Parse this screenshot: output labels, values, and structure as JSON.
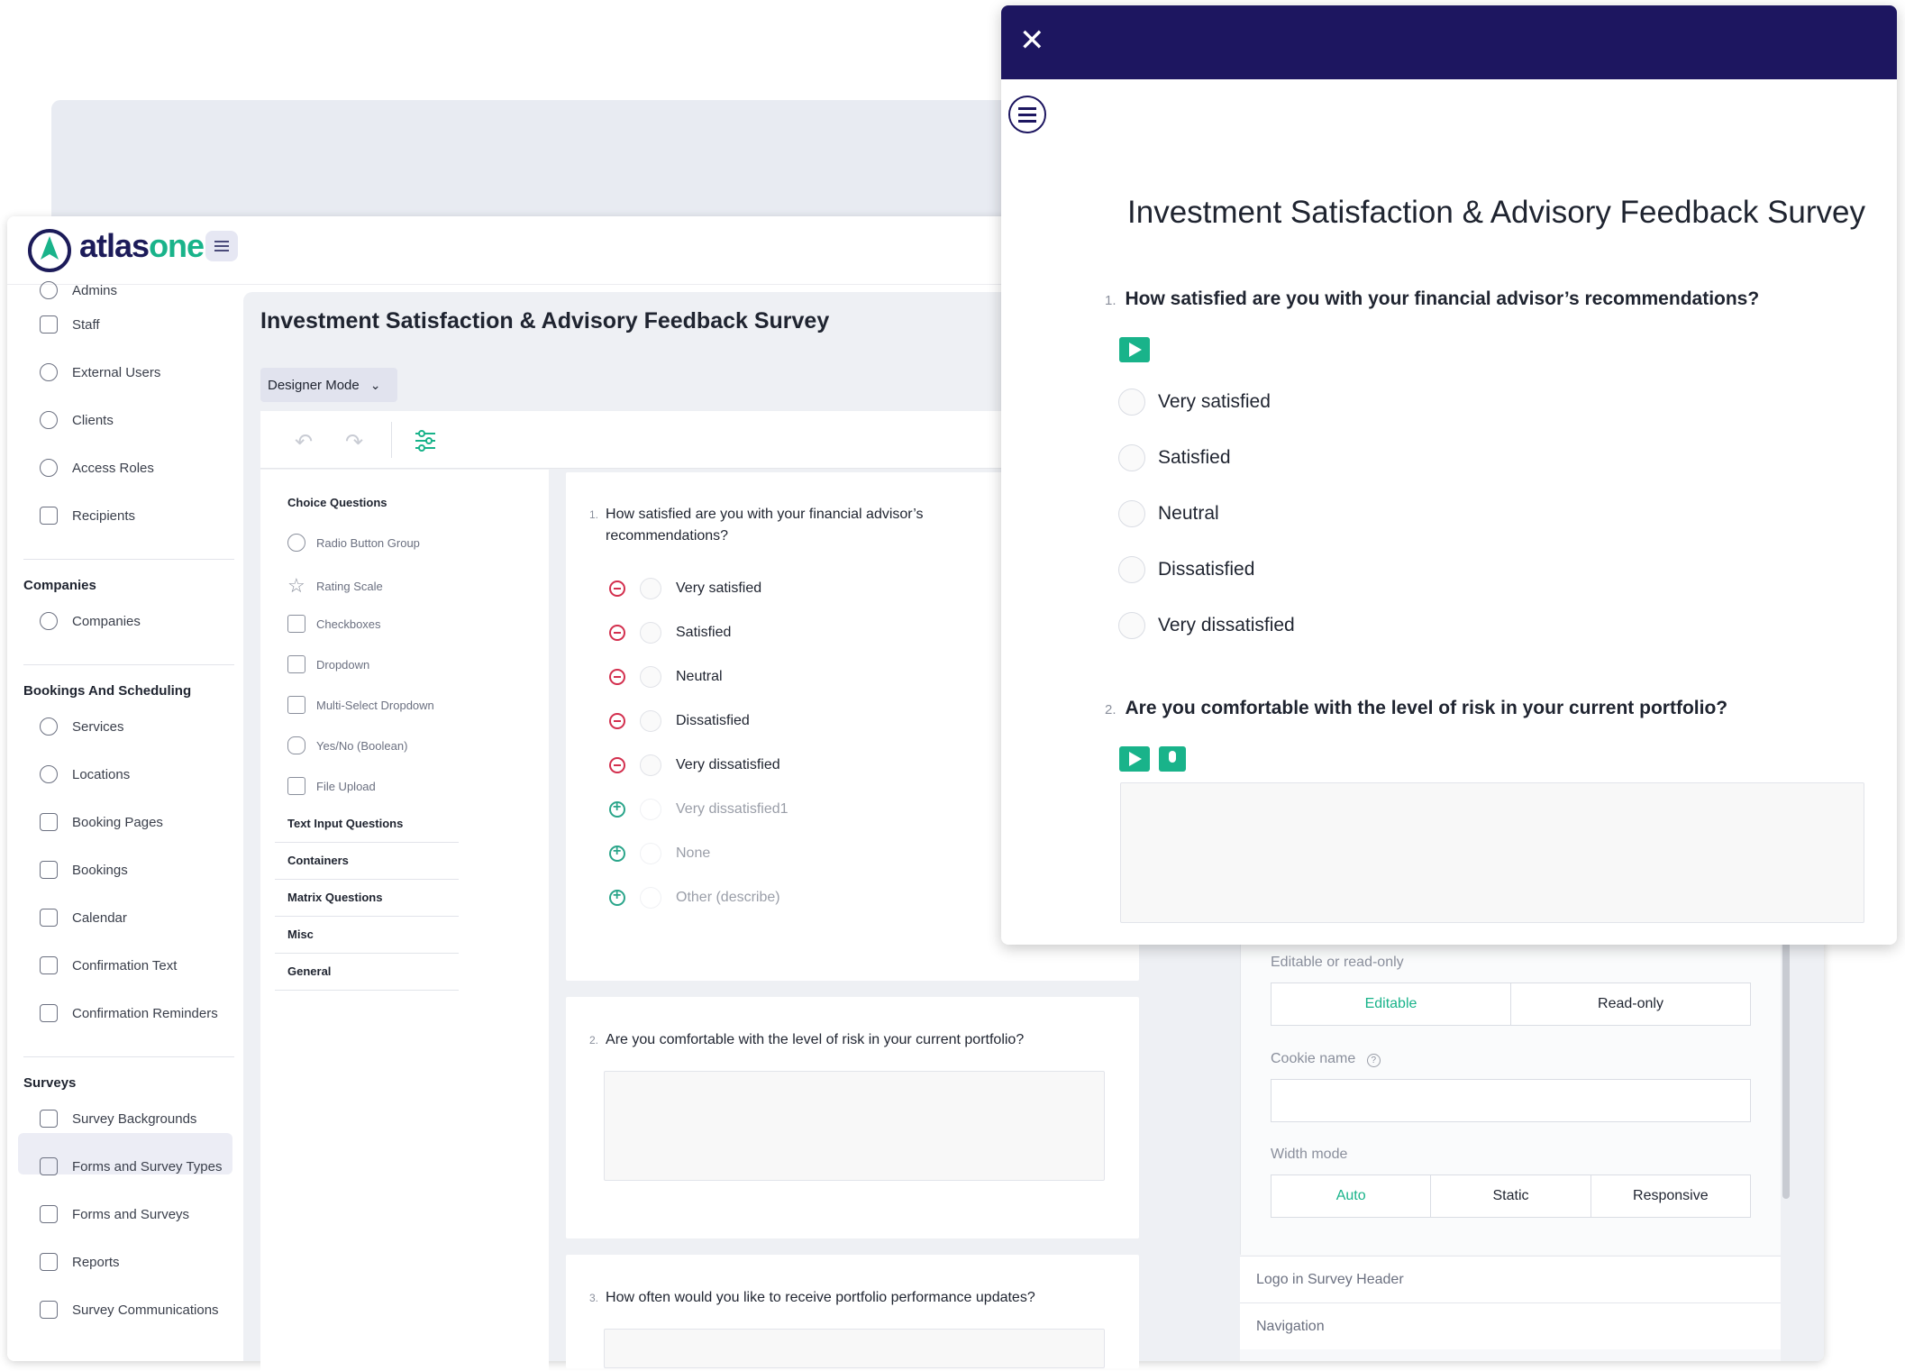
{
  "brand": {
    "logo_text_a": "atlas",
    "logo_text_b": "one"
  },
  "sidebar": {
    "cut_item": "Admins",
    "items_top": [
      "Staff",
      "External Users",
      "Clients",
      "Access Roles",
      "Recipients"
    ],
    "companies": {
      "heading": "Companies",
      "items": [
        "Companies"
      ]
    },
    "bookings": {
      "heading": "Bookings And Scheduling",
      "items": [
        "Services",
        "Locations",
        "Booking Pages",
        "Bookings",
        "Calendar",
        "Confirmation Text",
        "Confirmation Reminders"
      ]
    },
    "surveys": {
      "heading": "Surveys",
      "items": [
        "Survey Backgrounds",
        "Forms and Survey Types",
        "Forms and Surveys",
        "Reports",
        "Survey Communications"
      ],
      "active": "Forms and Survey Types"
    }
  },
  "editor": {
    "title": "Investment Satisfaction & Advisory Feedback Survey",
    "mode": "Designer Mode",
    "toolbox": {
      "choice_heading": "Choice Questions",
      "choice_items": [
        "Radio Button Group",
        "Rating Scale",
        "Checkboxes",
        "Dropdown",
        "Multi-Select Dropdown",
        "Yes/No (Boolean)",
        "File Upload"
      ],
      "categories": [
        "Text Input Questions",
        "Containers",
        "Matrix Questions",
        "Misc",
        "General"
      ]
    },
    "q1": {
      "num": "1.",
      "text_line1": "How satisfied are you with your financial advisor’s",
      "text_line2": "recommendations?",
      "options": [
        "Very satisfied",
        "Satisfied",
        "Neutral",
        "Dissatisfied",
        "Very dissatisfied"
      ],
      "add_options": [
        "Very dissatisfied1",
        "None",
        "Other (describe)"
      ]
    },
    "q2": {
      "num": "2.",
      "text": "Are you comfortable with the level of risk in your current portfolio?"
    },
    "q3": {
      "num": "3.",
      "text": "How often would you like to receive portfolio performance updates?"
    }
  },
  "properties": {
    "editable_label": "Editable or read-only",
    "editable_options": [
      "Editable",
      "Read-only"
    ],
    "editable_selected": "Editable",
    "cookie_label": "Cookie name",
    "width_label": "Width mode",
    "width_options": [
      "Auto",
      "Static",
      "Responsive"
    ],
    "width_selected": "Auto",
    "sections": [
      "Logo in Survey Header",
      "Navigation"
    ]
  },
  "preview": {
    "title": "Investment Satisfaction & Advisory Feedback Survey",
    "q1": {
      "num": "1.",
      "text": "How satisfied are you with your financial advisor’s recommendations?",
      "options": [
        "Very satisfied",
        "Satisfied",
        "Neutral",
        "Dissatisfied",
        "Very dissatisfied"
      ]
    },
    "q2": {
      "num": "2.",
      "text": "Are you comfortable with the level of risk in your current portfolio?"
    }
  },
  "colors": {
    "accent": "#19b38a",
    "header": "#1d1660",
    "remove": "#d32f4e"
  }
}
